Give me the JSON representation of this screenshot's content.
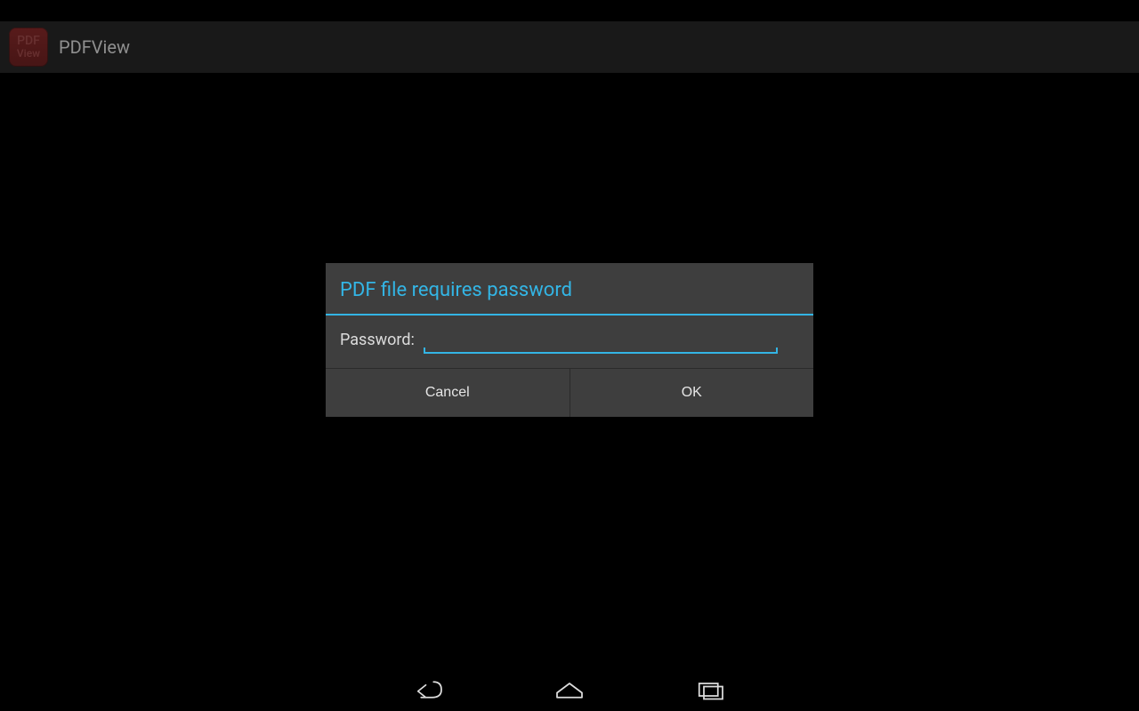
{
  "header": {
    "icon_line1": "PDF",
    "icon_line2": "View",
    "title": "PDFView"
  },
  "dialog": {
    "title": "PDF file requires password",
    "password_label": "Password:",
    "password_value": "",
    "cancel_label": "Cancel",
    "ok_label": "OK"
  },
  "colors": {
    "accent": "#33b5e5",
    "dialog_bg": "#3e3e3e"
  }
}
